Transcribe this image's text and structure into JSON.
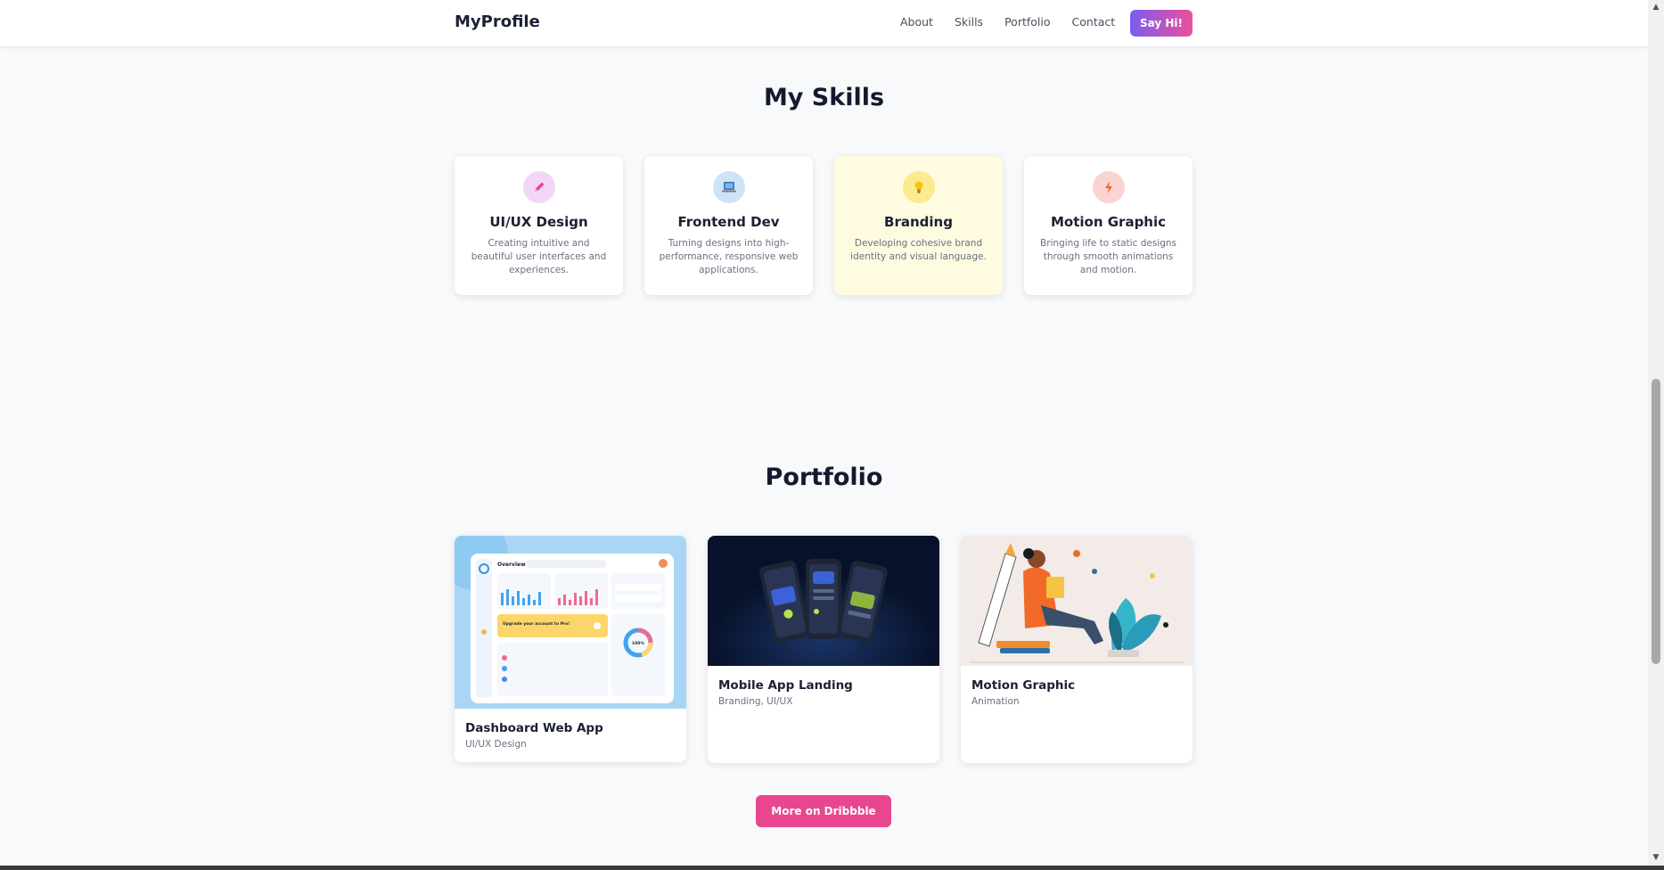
{
  "header": {
    "logo": "MyProfile",
    "nav": [
      "About",
      "Skills",
      "Portfolio",
      "Contact"
    ],
    "cta": "Say Hi!"
  },
  "skills": {
    "title": "My Skills",
    "items": [
      {
        "title": "UI/UX Design",
        "desc": "Creating intuitive and beautiful user interfaces and experiences.",
        "icon": "pencil-icon",
        "icon_bg": "#f3d6f7"
      },
      {
        "title": "Frontend Dev",
        "desc": "Turning designs into high-performance, responsive web applications.",
        "icon": "laptop-icon",
        "icon_bg": "#cfe3f7"
      },
      {
        "title": "Branding",
        "desc": "Developing cohesive brand identity and visual language.",
        "icon": "lightbulb-icon",
        "icon_bg": "#fbeb8e"
      },
      {
        "title": "Motion Graphic",
        "desc": "Bringing life to static designs through smooth animations and motion.",
        "icon": "lightning-icon",
        "icon_bg": "#fbd3d1"
      }
    ]
  },
  "portfolio": {
    "title": "Portfolio",
    "items": [
      {
        "title": "Dashboard Web App",
        "tag": "UI/UX Design"
      },
      {
        "title": "Mobile App Landing",
        "tag": "Branding, UI/UX"
      },
      {
        "title": "Motion Graphic",
        "tag": "Animation"
      }
    ],
    "dashboard_shot": {
      "header": "Overview",
      "banner": "Upgrade your account to Pro!",
      "donut": "100%"
    },
    "more_button": "More on Dribbble"
  },
  "colors": {
    "accent_pink": "#e8478f",
    "accent_purple": "#7b5cf0"
  }
}
